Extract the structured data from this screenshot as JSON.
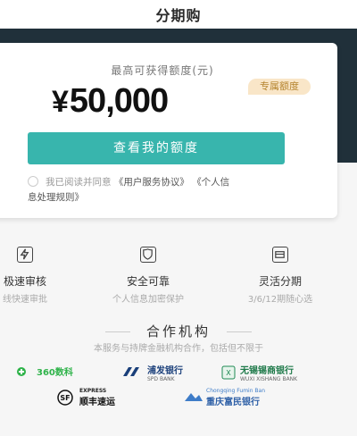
{
  "header": {
    "title": "分期购"
  },
  "card": {
    "quota_label": "最高可获得额度(元)",
    "currency": "¥",
    "amount": "50,000",
    "badge": "专属额度",
    "cta_label": "查看我的额度",
    "agree_prefix": "我已阅读并同意",
    "agreement_1": "《用户服务协议》",
    "agreement_2_part1": "《个人信",
    "agreement_2_part2": "息处理规则》"
  },
  "features": [
    {
      "title": "极速审核",
      "sub": "线快速审批",
      "icon": "lightning-icon"
    },
    {
      "title": "安全可靠",
      "sub": "个人信息加密保护",
      "icon": "shield-icon"
    },
    {
      "title": "灵活分期",
      "sub": "3/6/12期随心选",
      "icon": "card-icon"
    }
  ],
  "partners": {
    "title": "合作机构",
    "desc": "本服务与持牌金融机构合作，包括但不限于",
    "logos": [
      {
        "name": "360数科"
      },
      {
        "name": "浦发银行",
        "sub": "SPD BANK"
      },
      {
        "name": "无锡锡商银行",
        "sub": "WUXI XISHANG BANK"
      },
      {
        "name": "顺丰速运",
        "sub": "EXPRESS"
      },
      {
        "name": "重庆富民银行",
        "sub": "Chongqing Fumin Ban"
      }
    ]
  },
  "colors": {
    "accent": "#38b5ad",
    "hero": "#20303a",
    "badge_bg": "#f9e6c8",
    "badge_text": "#b5842e"
  }
}
